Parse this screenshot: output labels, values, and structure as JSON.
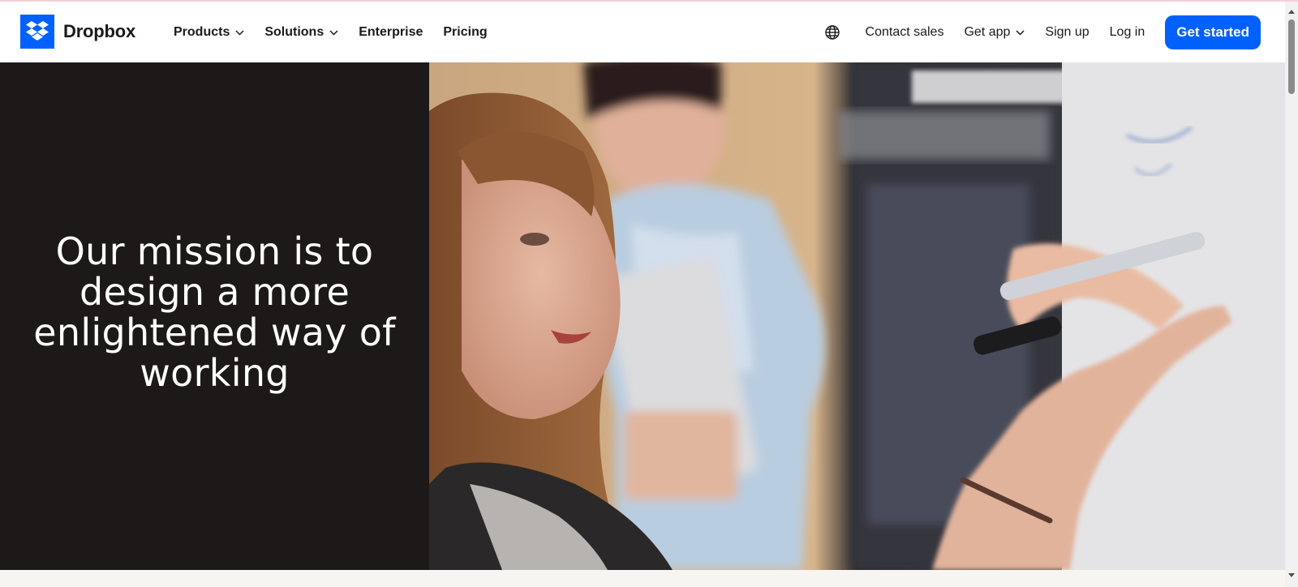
{
  "brand": {
    "name": "Dropbox",
    "color": "#0061fe"
  },
  "nav": {
    "left": [
      {
        "label": "Products",
        "dropdown": true
      },
      {
        "label": "Solutions",
        "dropdown": true
      },
      {
        "label": "Enterprise",
        "dropdown": false
      },
      {
        "label": "Pricing",
        "dropdown": false
      }
    ],
    "language_icon": "globe-icon",
    "contact_sales": "Contact sales",
    "get_app": "Get app",
    "sign_up": "Sign up",
    "log_in": "Log in",
    "get_started": "Get started"
  },
  "hero": {
    "title": "Our mission is to design a more enlightened way of working",
    "background": "#1e1919",
    "image_description_icon": "hero-photo"
  }
}
